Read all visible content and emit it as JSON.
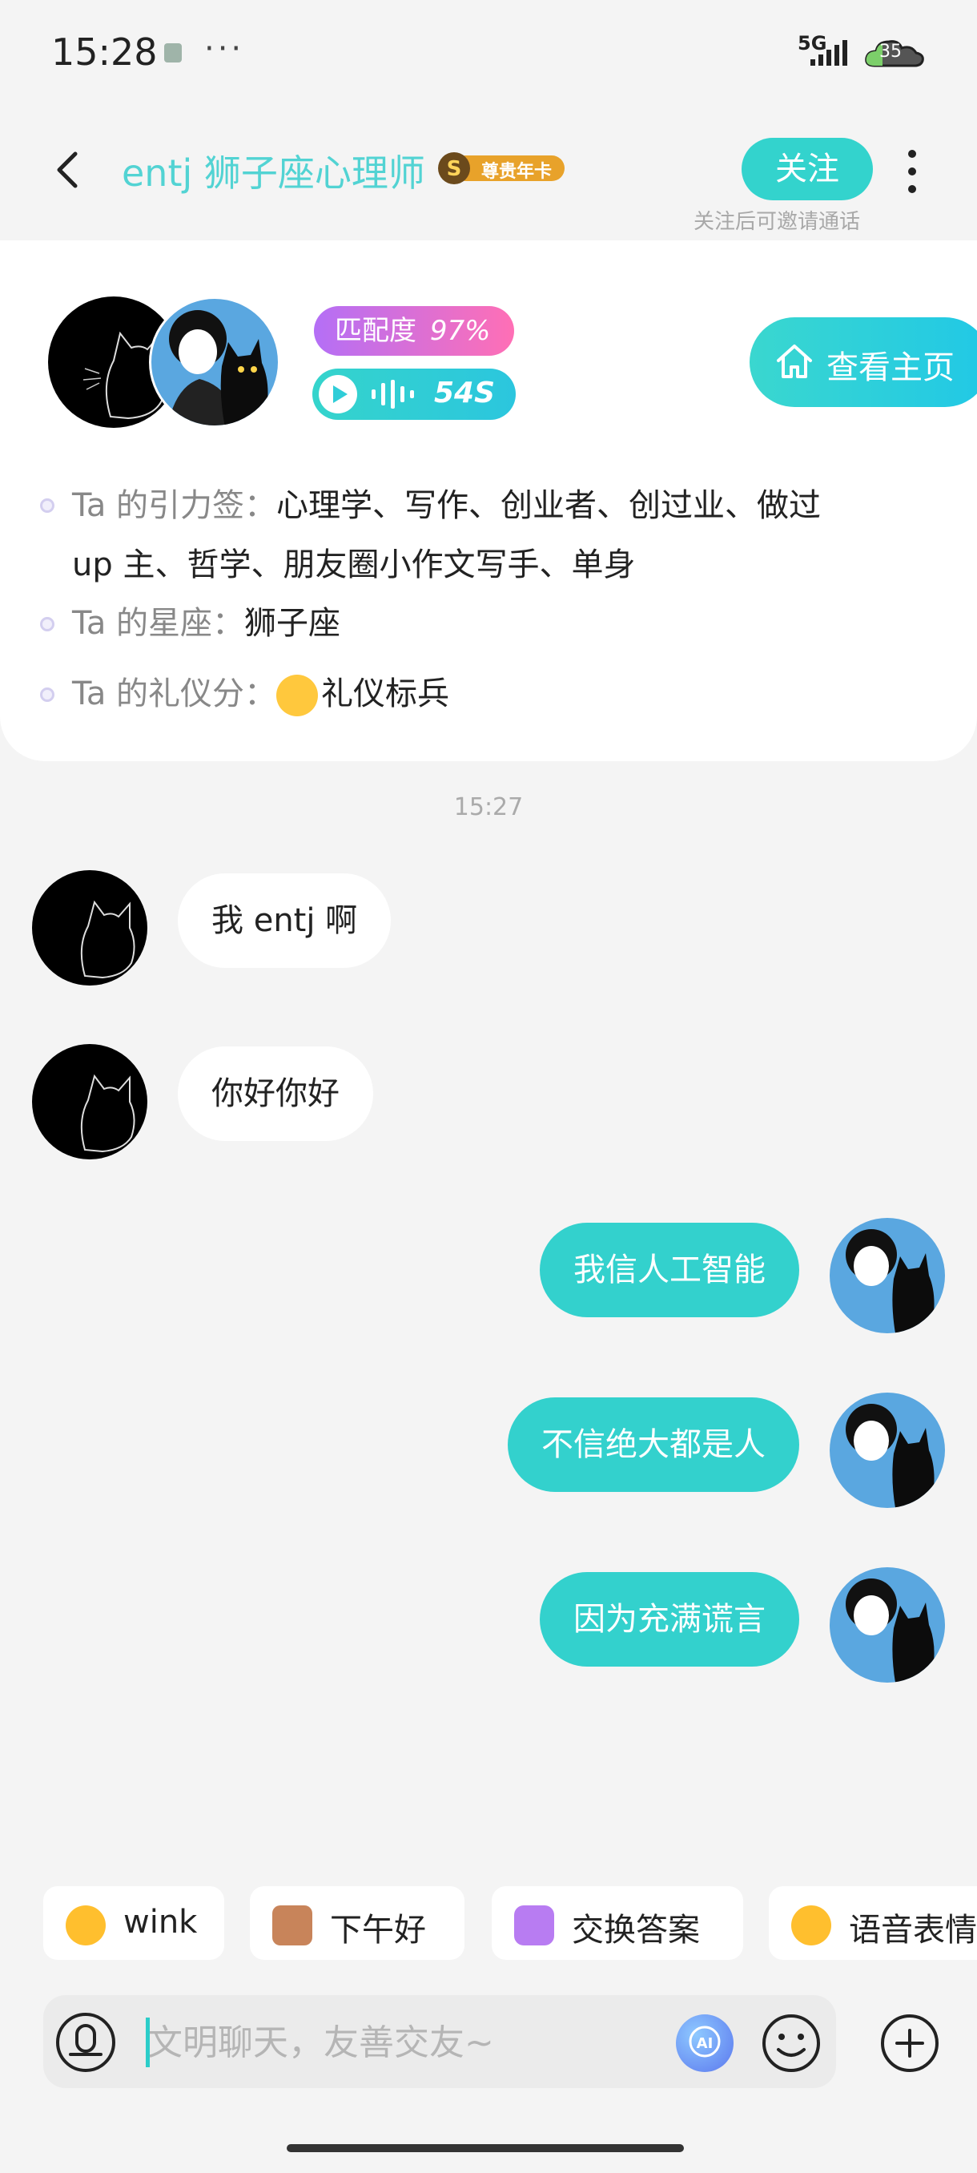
{
  "status_bar": {
    "time": "15:28",
    "more": "···",
    "network": "5G",
    "battery": "35"
  },
  "header": {
    "title": "entj 狮子座心理师",
    "vip_badge": "尊贵年卡",
    "follow_label": "关注",
    "follow_hint": "关注后可邀请通话"
  },
  "profile": {
    "match_label": "匹配度",
    "match_value": "97%",
    "voice_duration": "54S",
    "home_button": "查看主页",
    "tags_label": "Ta 的引力签：",
    "tags_line1": "心理学、写作、创业者、创过业、做过",
    "tags_line2": "up 主、哲学、朋友圈小作文写手、单身",
    "zodiac_label": "Ta 的星座：",
    "zodiac_value": "狮子座",
    "etiquette_label": "Ta 的礼仪分：",
    "etiquette_value": "礼仪标兵"
  },
  "chat": {
    "timestamp": "15:27",
    "messages": [
      {
        "side": "in",
        "text": "我 entj 啊"
      },
      {
        "side": "in",
        "text": "你好你好"
      },
      {
        "side": "out",
        "text": "我信人工智能"
      },
      {
        "side": "out",
        "text": "不信绝大都是人"
      },
      {
        "side": "out",
        "text": "因为充满谎言"
      }
    ]
  },
  "quick_replies": [
    {
      "label": "wink",
      "icon": "wink-face-icon"
    },
    {
      "label": "下午好",
      "icon": "coffee-icon"
    },
    {
      "label": "交换答案",
      "icon": "exchange-icon"
    },
    {
      "label": "语音表情",
      "icon": "voice-emoji-icon"
    }
  ],
  "input": {
    "placeholder": "文明聊天，友善交友~"
  },
  "colors": {
    "accent": "#33d3cd",
    "title": "#52d3d3",
    "match_gradient": [
      "#b46ff6",
      "#ff6fb5"
    ]
  }
}
